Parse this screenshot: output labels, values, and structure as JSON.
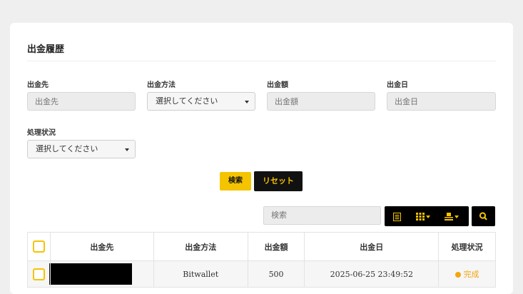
{
  "panel": {
    "title": "出金履歴"
  },
  "filters": {
    "destination": {
      "label": "出金先",
      "placeholder": "出金先"
    },
    "method": {
      "label": "出金方法",
      "selected": "選択してください"
    },
    "amount": {
      "label": "出金額",
      "placeholder": "出金額"
    },
    "date": {
      "label": "出金日",
      "placeholder": "出金日"
    },
    "status": {
      "label": "処理状況",
      "selected": "選択してください"
    }
  },
  "buttons": {
    "search": "検索",
    "reset": "リセット"
  },
  "toolbar": {
    "search_placeholder": "検索",
    "icons": [
      "list-icon",
      "columns-icon",
      "export-icon",
      "search-icon"
    ]
  },
  "table": {
    "columns": [
      "出金先",
      "出金方法",
      "出金額",
      "出金日",
      "処理状況"
    ],
    "rows": [
      {
        "destination": "",
        "method": "Bitwallet",
        "amount": "500",
        "date": "2025-06-25 23:49:52",
        "status": "完成"
      }
    ]
  },
  "colors": {
    "accent": "#f5c400",
    "dark": "#000000",
    "status_done": "#f2a60f"
  }
}
